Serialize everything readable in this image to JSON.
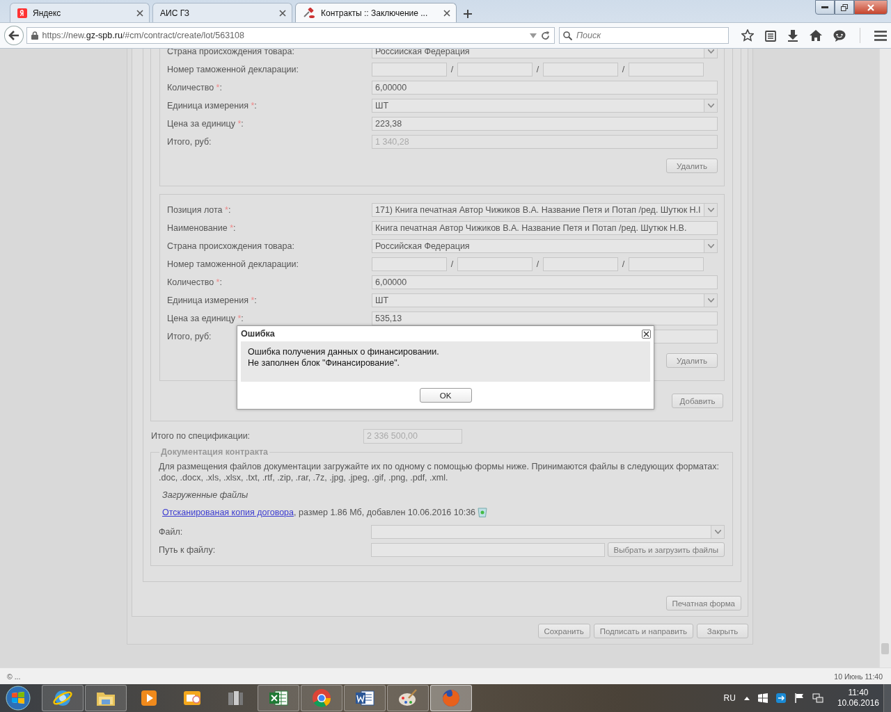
{
  "browser": {
    "tabs": [
      {
        "title": "Яндекс",
        "kind": "ya",
        "selected": false
      },
      {
        "title": "АИС ГЗ",
        "selected": false
      },
      {
        "title": "Контракты :: Заключение ...",
        "kind": "gavel",
        "selected": true
      }
    ],
    "url": {
      "prefix": "https://new.",
      "domain": "gz-spb.ru",
      "path": "/#cm/contract/create/lot/563108"
    },
    "search": {
      "placeholder": "Поиск"
    }
  },
  "positions": [
    {
      "fields": [
        {
          "kind": "select",
          "label": "Страна происхождения товара:",
          "value": "Российская Федерация"
        },
        {
          "kind": "customs",
          "label": "Номер таможенной декларации:",
          "separators": [
            "/",
            "/",
            "/"
          ]
        },
        {
          "kind": "text",
          "label": "Количество",
          "required_mark": "*",
          "label_end": ":",
          "value": "6,00000"
        },
        {
          "kind": "select",
          "label": "Единица измерения",
          "required_mark": "*",
          "label_end": ":",
          "value": "ШТ"
        },
        {
          "kind": "text",
          "label": "Цена за единицу",
          "required_mark": "*",
          "label_end": ":",
          "value": "223,38"
        },
        {
          "kind": "text",
          "label": "Итого, руб:",
          "value": "1 340,28",
          "disabled": true
        }
      ],
      "delete_button": "Удалить"
    },
    {
      "fields": [
        {
          "kind": "select",
          "label": "Позиция лота",
          "required_mark": "*",
          "label_end": ":",
          "value": "171) Книга печатная Автор Чижиков В.А. Название Петя и Потап /ред. Шутюк Н.І"
        },
        {
          "kind": "text",
          "label": "Наименование",
          "required_mark": "*",
          "label_end": ":",
          "value": "Книга печатная Автор Чижиков В.А. Название Петя и Потап /ред. Шутюк Н.В."
        },
        {
          "kind": "select",
          "label": "Страна происхождения товара:",
          "value": "Российская Федерация"
        },
        {
          "kind": "customs",
          "label": "Номер таможенной декларации:",
          "separators": [
            "/",
            "/",
            "/"
          ]
        },
        {
          "kind": "text",
          "label": "Количество",
          "required_mark": "*",
          "label_end": ":",
          "value": "6,00000"
        },
        {
          "kind": "select",
          "label": "Единица измерения",
          "required_mark": "*",
          "label_end": ":",
          "value": "ШТ"
        },
        {
          "kind": "text",
          "label": "Цена за единицу",
          "required_mark": "*",
          "label_end": ":",
          "value": "535,13"
        },
        {
          "kind": "text",
          "label": "Итого, руб:"
        }
      ],
      "delete_button": "Удалить"
    }
  ],
  "add_button": "Добавить",
  "spec_total": {
    "label": "Итого по спецификации:",
    "value": "2 336 500,00",
    "disabled": true
  },
  "documents": {
    "legend": "Документация контракта",
    "note": "Для размещения файлов документации загружайте их по одному с помощью формы ниже. Принимаются файлы в следующих форматах: .doc, .docx, .xls, .xlsx, .txt, .rtf, .zip, .rar, .7z, .jpg, .jpeg, .gif, .png, .pdf, .xml.",
    "uploaded_title": "Загруженные файлы",
    "files": [
      {
        "link": "Отсканированая копия договора",
        "details": ", размер 1.86 Мб, добавлен 10.06.2016 10:36"
      }
    ],
    "file_field": {
      "label": "Файл:"
    },
    "path_field": {
      "label": "Путь к файлу:",
      "button": "Выбрать и загрузить файлы"
    }
  },
  "print_button": "Печатная форма",
  "footer_buttons": [
    "Сохранить",
    "Подписать и направить",
    "Закрыть"
  ],
  "dialog": {
    "title": "Ошибка",
    "message": [
      "Ошибка получения данных о финансировании.",
      "Не заполнен блок \"Финансирование\"."
    ],
    "button": "OK"
  },
  "status_bar": {
    "left": "© ...",
    "right": "10 Июнь 11:40"
  },
  "taskbar": {
    "apps": [
      {
        "kind": "ie",
        "running": true,
        "selected": false
      },
      {
        "kind": "explorer",
        "running": true,
        "selected": false
      },
      {
        "kind": "media",
        "running": false,
        "selected": false
      },
      {
        "kind": "outlook",
        "running": false,
        "selected": false
      },
      {
        "kind": "servers",
        "running": false,
        "selected": false
      },
      {
        "kind": "excel",
        "running": true,
        "selected": false
      },
      {
        "kind": "chrome",
        "running": true,
        "selected": false
      },
      {
        "kind": "word",
        "running": true,
        "selected": false
      },
      {
        "kind": "paint",
        "running": true,
        "selected": false
      },
      {
        "kind": "firefox",
        "running": true,
        "selected": true
      }
    ],
    "language": "RU",
    "time": "11:40",
    "date": "10.06.2016"
  }
}
